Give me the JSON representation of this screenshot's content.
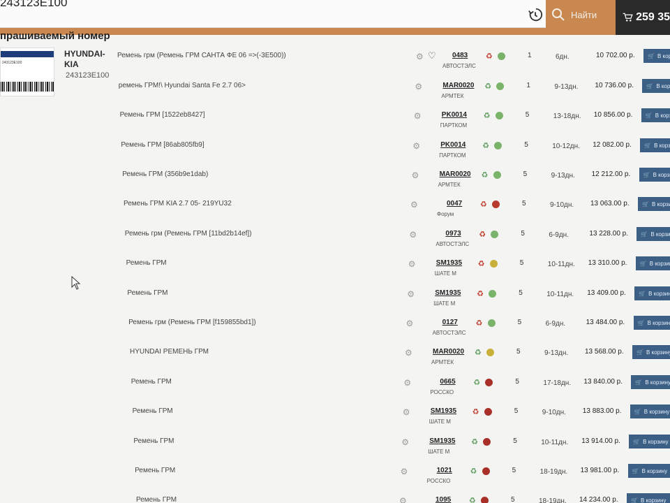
{
  "search": {
    "value": "243123E100",
    "button_label": "Найти"
  },
  "cart": {
    "amount": "259 35"
  },
  "section": {
    "title": "прашиваемый номер"
  },
  "product": {
    "thumb_band": "SPARE PARTS",
    "thumb_code": "243123E100",
    "thumb_sub": "243123E100",
    "brand": "HYUNDAI-KIA",
    "article": "243123E100"
  },
  "colors": {
    "accent": "#c9884f",
    "cart_button": "#3c5f86",
    "dark": "#2a2a2a"
  },
  "cart_button_label": "В корзину",
  "offers": [
    {
      "desc": "Ремень грм (Ремень ГРМ САНТА ФЕ 06 =>(-3E500))",
      "code": "0483",
      "supplier": "АВТОСТЭЛС",
      "recycle": "red",
      "dot": "#7ab46a",
      "qty": "1",
      "days": "6дн.",
      "price": "10 702.00 р.",
      "heart": true
    },
    {
      "desc": "ремень ГРМ!\\ Hyundai Santa Fe 2.7 06>",
      "code": "MAR0020",
      "supplier": "АРМТЕК",
      "recycle": "green",
      "dot": "#7ab46a",
      "qty": "1",
      "days": "9-13дн.",
      "price": "10 736.00 р."
    },
    {
      "desc": "Ремень ГРМ [1522eb8427]",
      "code": "PK0014",
      "supplier": "ПАРТКОМ",
      "recycle": "green",
      "dot": "#7ab46a",
      "qty": "5",
      "days": "13-18дн.",
      "price": "10 856.00 р."
    },
    {
      "desc": "Ремень ГРМ [86ab805fb9]",
      "code": "PK0014",
      "supplier": "ПАРТКОМ",
      "recycle": "green",
      "dot": "#7ab46a",
      "qty": "5",
      "days": "10-12дн.",
      "price": "12 082.00 р."
    },
    {
      "desc": "Ремень ГРМ (356b9e1dab)",
      "code": "MAR0020",
      "supplier": "АРМТЕК",
      "recycle": "green",
      "dot": "#7ab46a",
      "qty": "5",
      "days": "9-13дн.",
      "price": "12 212.00 р."
    },
    {
      "desc": "Ремень ГРМ KIA 2.7 05- 219YU32",
      "code": "0047",
      "supplier": "Форум",
      "recycle": "red",
      "dot": "#b83a2e",
      "qty": "5",
      "days": "9-10дн.",
      "price": "13 063.00 р."
    },
    {
      "desc": "Ремень грм (Ремень ГРМ [11bd2b14ef])",
      "code": "0973",
      "supplier": "АВТОСТЭЛС",
      "recycle": "red",
      "dot": "#7ab46a",
      "qty": "5",
      "days": "6-9дн.",
      "price": "13 228.00 р."
    },
    {
      "desc": "Ремень ГРМ",
      "code": "SM1935",
      "supplier": "ШАТЕ М",
      "recycle": "red",
      "dot": "#c9b03a",
      "qty": "5",
      "days": "10-11дн.",
      "price": "13 310.00 р."
    },
    {
      "desc": "Ремень ГРМ",
      "code": "SM1935",
      "supplier": "ШАТЕ М",
      "recycle": "red",
      "dot": "#7ab46a",
      "qty": "5",
      "days": "10-11дн.",
      "price": "13 409.00 р."
    },
    {
      "desc": "Ремень грм (Ремень ГРМ [f159855bd1])",
      "code": "0127",
      "supplier": "АВТОСТЭЛС",
      "recycle": "red",
      "dot": "#7ab46a",
      "qty": "5",
      "days": "6-9дн.",
      "price": "13 484.00 р."
    },
    {
      "desc": "HYUNDAI РЕМЕНЬ ГРМ",
      "code": "MAR0020",
      "supplier": "АРМТЕК",
      "recycle": "green",
      "dot": "#c9b03a",
      "qty": "5",
      "days": "9-13дн.",
      "price": "13 568.00 р."
    },
    {
      "desc": "Ремень ГРМ",
      "code": "0665",
      "supplier": "РОССКО",
      "recycle": "green",
      "dot": "#a83028",
      "qty": "5",
      "days": "17-18дн.",
      "price": "13 840.00 р."
    },
    {
      "desc": "Ремень ГРМ",
      "code": "SM1935",
      "supplier": "ШАТЕ М",
      "recycle": "red",
      "dot": "#a83028",
      "qty": "5",
      "days": "9-10дн.",
      "price": "13 883.00 р."
    },
    {
      "desc": "Ремень ГРМ",
      "code": "SM1935",
      "supplier": "ШАТЕ М",
      "recycle": "green",
      "dot": "#a83028",
      "qty": "5",
      "days": "10-11дн.",
      "price": "13 914.00 р."
    },
    {
      "desc": "Ремень ГРМ",
      "code": "1021",
      "supplier": "РОССКО",
      "recycle": "green",
      "dot": "#a83028",
      "qty": "5",
      "days": "18-19дн.",
      "price": "13 981.00 р."
    },
    {
      "desc": "Ремень ГРМ",
      "code": "1095",
      "supplier": "РОССКО",
      "recycle": "green",
      "dot": "#a83028",
      "qty": "5",
      "days": "18-19дн.",
      "price": "14 234.00 р."
    }
  ]
}
